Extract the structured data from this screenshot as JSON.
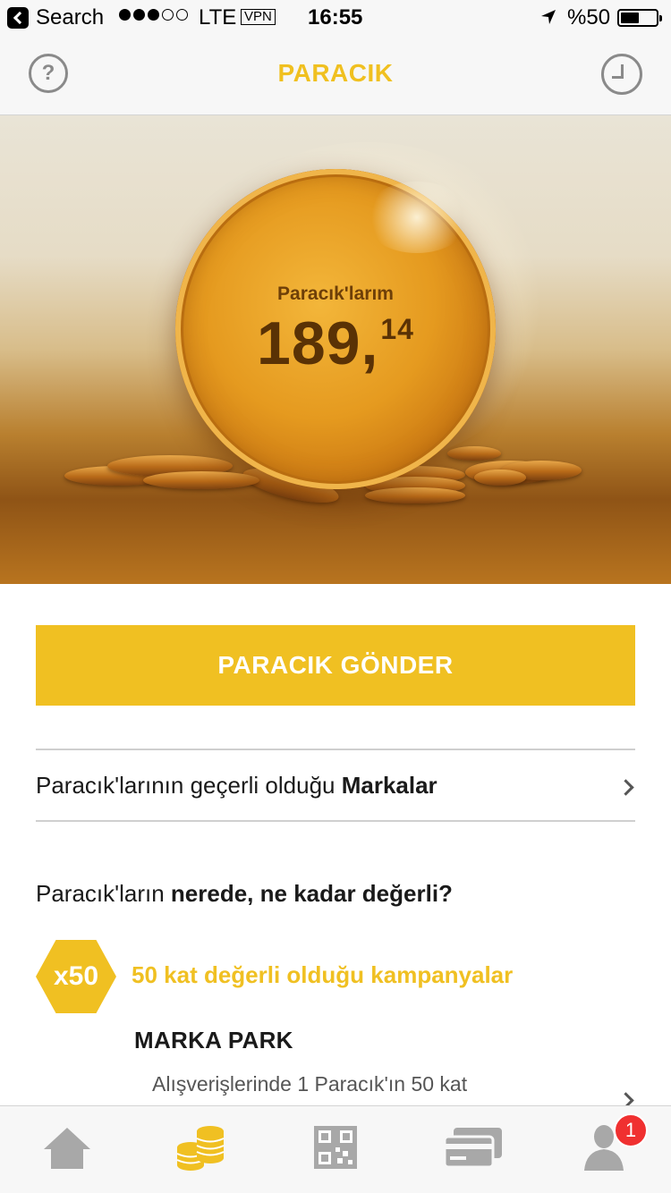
{
  "status_bar": {
    "back_label": "Search",
    "carrier": "LTE",
    "vpn": "VPN",
    "time": "16:55",
    "battery": "%50",
    "signal_bars_on": 3,
    "signal_bars_total": 5
  },
  "nav": {
    "title": "PARACIK",
    "help_symbol": "?",
    "left_icon": "help-icon",
    "right_icon": "history-clock-icon"
  },
  "hero": {
    "label": "Paracık'larım",
    "balance_int": "189,",
    "balance_dec": "14"
  },
  "send_button": {
    "label": "PARACIK GÖNDER"
  },
  "brands_row": {
    "prefix": "Paracık'larının geçerli olduğu ",
    "bold": "Markalar"
  },
  "section": {
    "prefix": "Paracık'ların ",
    "bold": "nerede, ne kadar değerli?"
  },
  "campaign": {
    "multiplier": "x50",
    "title": "50 kat değerli olduğu kampanyalar",
    "brand": "MARKA PARK",
    "description": "Alışverişlerinde 1 Paracık'ın 50 kat"
  },
  "tabs": [
    {
      "icon": "home-icon",
      "active": false
    },
    {
      "icon": "coins-icon",
      "active": true
    },
    {
      "icon": "qr-code-icon",
      "active": false
    },
    {
      "icon": "credit-card-icon",
      "active": false
    },
    {
      "icon": "profile-icon",
      "active": false
    }
  ],
  "profile_badge": "1",
  "colors": {
    "accent": "#f0c022",
    "inactive_icon": "#a8a8a8",
    "badge": "#f03030"
  }
}
